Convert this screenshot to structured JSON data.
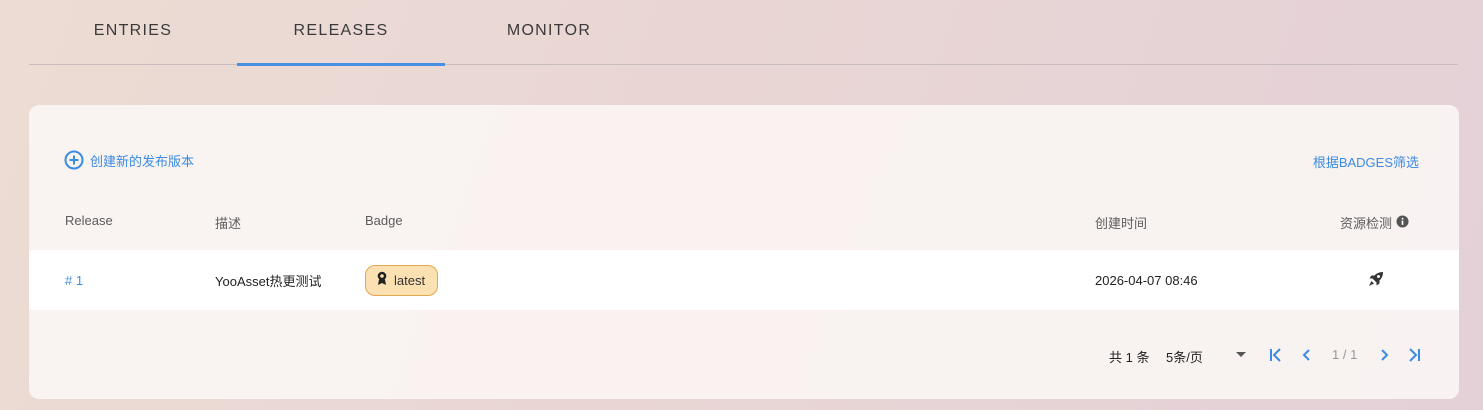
{
  "tabs": [
    {
      "label": "ENTRIES",
      "active": false
    },
    {
      "label": "RELEASES",
      "active": true
    },
    {
      "label": "MONITOR",
      "active": false
    }
  ],
  "toolbar": {
    "create_label": "创建新的发布版本",
    "filter_label": "根据BADGES筛选"
  },
  "table": {
    "headers": [
      "Release",
      "描述",
      "Badge",
      "创建时间",
      "资源检测"
    ],
    "rows": [
      {
        "release": "# 1",
        "description": "YooAsset热更测试",
        "badge": "latest",
        "created": "2026-04-07 08:46",
        "check_icon": "rocket-icon"
      }
    ]
  },
  "pagination": {
    "total": "共 1 条",
    "per_page": "5条/页",
    "page_info": "1 / 1"
  },
  "colors": {
    "accent": "#3b8be0",
    "badge_bg": "#fbe0b2",
    "badge_border": "#e3a752"
  }
}
